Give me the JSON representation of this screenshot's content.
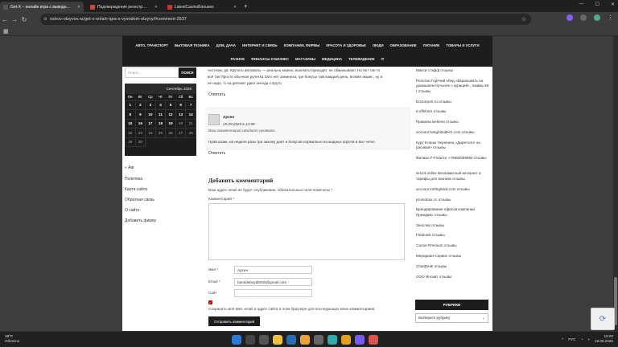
{
  "browser": {
    "tabs": [
      {
        "title": "Get-X – онлайн игра с выводо…",
        "color": "#444"
      },
      {
        "title": "Подтверждение регистр…",
        "color": "#d44638"
      },
      {
        "title": "LatestCasinoBonuses",
        "color": "#c33"
      }
    ],
    "url": "ostrov-otzyvov.ru/get-x-onlain-igra-s-vyvodom-otzyvy/#comment-2537"
  },
  "nav": {
    "row1": [
      "АВТО, ТРАНСПОРТ",
      "БЫТОВАЯ ТЕХНИКА",
      "ДОМ, ДАЧА",
      "ИНТЕРНЕТ И СВЯЗЬ",
      "КОМПАНИИ, ФИРМЫ",
      "КРАСОТА И ЗДОРОВЬЕ",
      "ЛЮДИ",
      "ОБРАЗОВАНИЕ",
      "ПИТАНИЕ",
      "ТОВАРЫ И УСЛУГИ"
    ],
    "row2": [
      "РАЗНОЕ",
      "ФИНАНСЫ И БИЗНЕС",
      "МАГАЗИНЫ",
      "МЕДИЦИНА",
      "ТЕЛЕВИДЕНИЕ",
      "IT"
    ]
  },
  "sidebar_left": {
    "search_placeholder": "Поиск...",
    "search_button": "ПОИСК",
    "calendar": {
      "title": "Сентябрь 2025",
      "weekdays": [
        "Пн",
        "Вт",
        "Ср",
        "Чт",
        "Пт",
        "Сб",
        "Вс"
      ],
      "weeks": [
        [
          "1",
          "2",
          "3",
          "4",
          "5",
          "6",
          "7"
        ],
        [
          "8",
          "9",
          "10",
          "11",
          "12",
          "13",
          "14"
        ],
        [
          "15",
          "16",
          "17",
          "18",
          "19",
          "20",
          "21"
        ],
        [
          "22",
          "23",
          "24",
          "25",
          "26",
          "27",
          "28"
        ],
        [
          "29",
          "30",
          "",
          "",
          "",
          "",
          ""
        ]
      ]
    },
    "prev": "« Авг",
    "links": [
      "Политика",
      "Карта сайта",
      "Обратная связь",
      "О сайте",
      "Добавить фирму"
    ]
  },
  "comments": {
    "prev_text_1": "честном, да. Крутить автоматы — реально можно, выплаты приходят, не обманывают. Но вот так-то",
    "prev_text_2": "всё так Просто обычная рулетка Зато нет замануха, где бонусы там каждый день, всякие акции , ну и",
    "prev_text_3": "не надо, ½ на депозит дают иногда к 4руто",
    "reply": "Ответить",
    "author": "Арсен",
    "date": "19.09.2025 в 14:59",
    "moderation": "Ваш комментарий ожидает проверки.",
    "text": "Нрав казик, на неделе раза три захожу дает и бонусов нормально на жадных корочи и все четко",
    "reply2": "Ответить"
  },
  "form": {
    "title": "Добавить комментарий",
    "note": "Ваш адрес email не будет опубликован. Обязательные поля помечены *",
    "comment_label": "Комментарий *",
    "name_label": "Имя *",
    "name_value": "Арсен",
    "email_label": "Email *",
    "email_value": "haroldeboyd5040@gmail.com",
    "site_label": "Сайт",
    "checkbox_label": "Сохранить моё имя, email и адрес сайта в этом браузере для последующих моих комментариев.",
    "submit": "Отправить комментарий"
  },
  "sidebar_right": {
    "links": [
      "Макси стафф отзывы",
      "Ролотан Горячий обед «Вкрапывать на домашнем бутыоне с курицей», такимь 60 / отзывы",
      "Doctorport.ru отзывы",
      "it-offshore отзывы",
      "Правила мебели отзывы",
      "account.bvkglobaltech.com отзывы",
      "Курс Елены Черненец «Диретолог на расивая» отзывы",
      "Филиал F-Finance +79650059950 отзывы",
      "sim24.online Безлимитный интернет и тарифы для звонков отзывы",
      "account.imfrkglobal.com отзывы",
      "promobox.cc отзывы",
      "Брендирование офисов компании ПремДекс отзывы",
      "Зенслер отзывы",
      "Fitobonik отзывы",
      "Салон Premium отзывы",
      "Меридиан-Сервис отзывы",
      "ChatiDesk отзывы",
      "ООО Инсайт отзывы"
    ],
    "rubrics_title": "РУБРИКИ",
    "rubrics_select": "Выберите рубрику"
  },
  "taskbar": {
    "temp": "19°C",
    "weather": "Облачно",
    "lang": "РУС",
    "time": "15:00",
    "date": "19.09.2025"
  }
}
